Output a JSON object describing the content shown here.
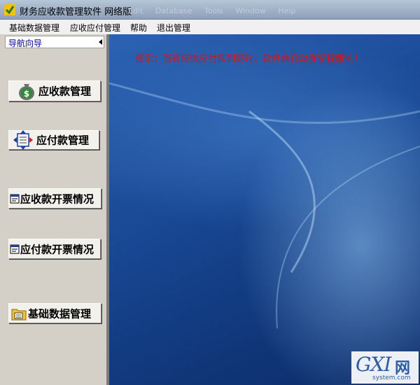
{
  "window": {
    "title": "财务应收款管理软件  网络版",
    "ghost_menu": [
      "Edit",
      "Database",
      "Tools",
      "Window",
      "Help"
    ]
  },
  "menu": [
    "基础数据管理",
    "应收应付管理",
    "帮助",
    "退出管理"
  ],
  "nav": {
    "header": "导航向导",
    "buttons": [
      {
        "label": "应收款管理",
        "icon": "money-bag-icon"
      },
      {
        "label": "应付款管理",
        "icon": "ledger-arrows-icon"
      },
      {
        "label": "应收款开票情况",
        "icon": "invoice-icon"
      },
      {
        "label": "应付款开票情况",
        "icon": "invoice-icon"
      },
      {
        "label": "基础数据管理",
        "icon": "folder-data-icon"
      }
    ]
  },
  "notice": "提示：当有应收应付款到期时，软件会自动弹窗提醒的！",
  "watermark": {
    "logo": "GXI",
    "wang": "网",
    "site": "system.com"
  },
  "colors": {
    "notice": "#e01010",
    "nav_header_text": "#0000a0",
    "desktop": "#1c4c99"
  }
}
